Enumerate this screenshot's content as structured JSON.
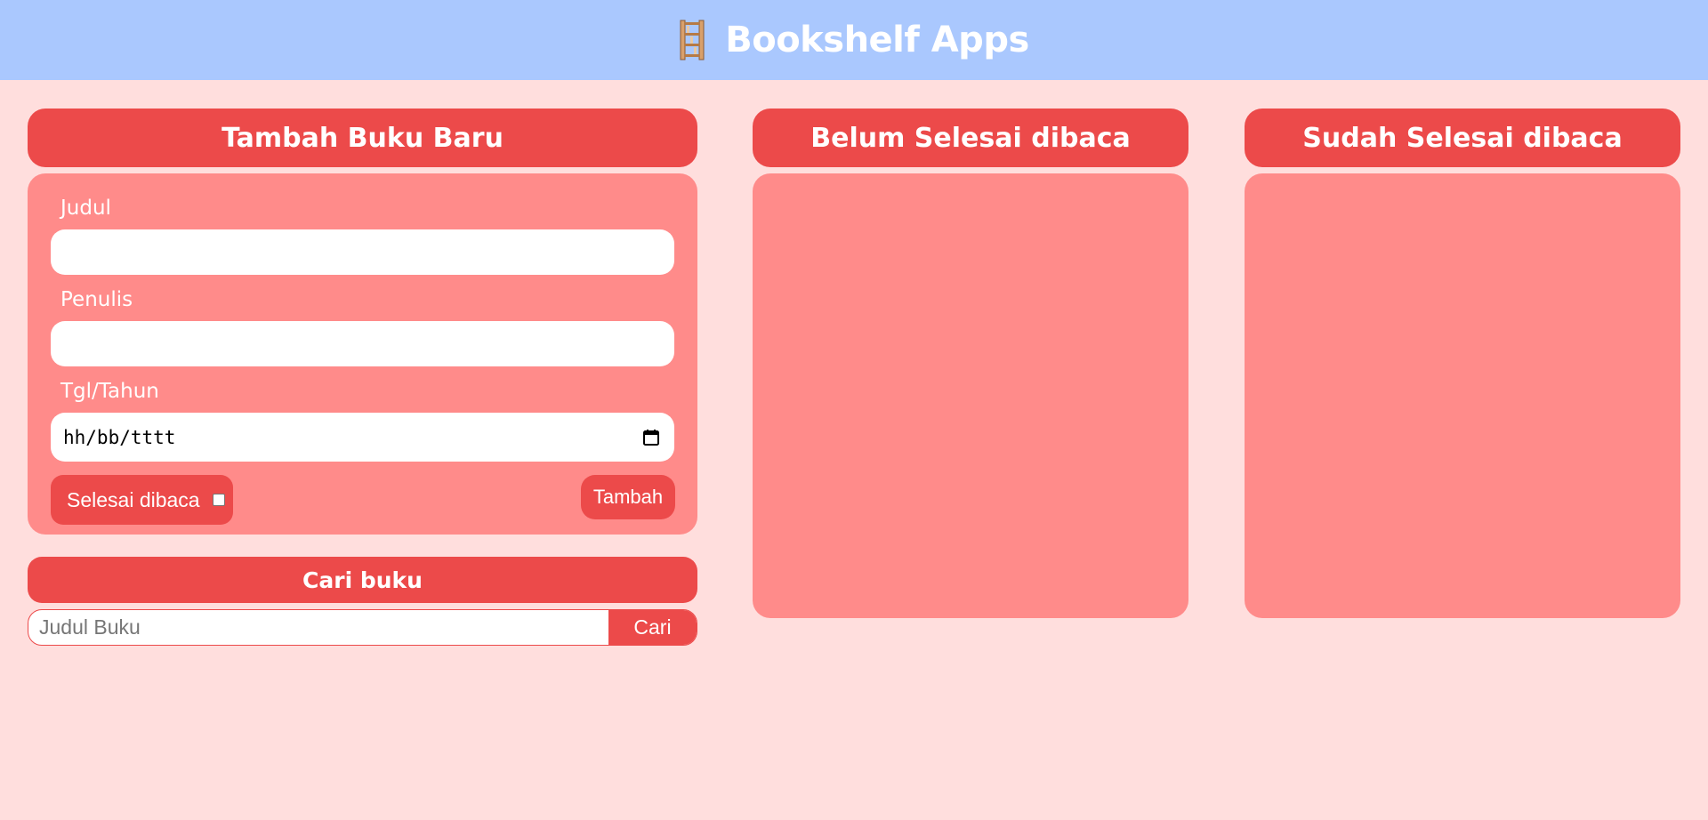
{
  "header": {
    "title": "Bookshelf Apps",
    "logo_icon": "bookshelf-icon"
  },
  "colors": {
    "header_bg": "#aac8fe",
    "page_bg": "#ffdedd",
    "accent": "#ec4a4a",
    "panel_bg": "#ff8b8a"
  },
  "add_form": {
    "title": "Tambah Buku Baru",
    "title_label": "Judul",
    "title_value": "",
    "author_label": "Penulis",
    "author_value": "",
    "date_label": "Tgl/Tahun",
    "date_placeholder": "hh/bb/tttt",
    "finished_label": "Selesai dibaca",
    "finished_checked": false,
    "submit_label": "Tambah"
  },
  "search": {
    "title": "Cari buku",
    "placeholder": "Judul Buku",
    "button_label": "Cari"
  },
  "shelves": {
    "unread_title": "Belum Selesai dibaca",
    "read_title": "Sudah Selesai dibaca"
  }
}
